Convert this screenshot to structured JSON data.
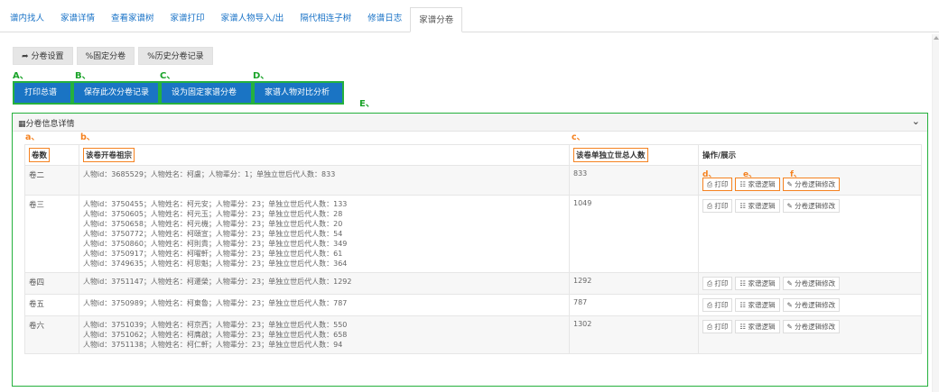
{
  "nav": {
    "tabs": [
      {
        "label": "谱内找人",
        "active": false
      },
      {
        "label": "家谱详情",
        "active": false
      },
      {
        "label": "查看家谱树",
        "active": false
      },
      {
        "label": "家谱打印",
        "active": false
      },
      {
        "label": "家谱人物导入/出",
        "active": false
      },
      {
        "label": "隔代相连子树",
        "active": false
      },
      {
        "label": "修谱日志",
        "active": false
      },
      {
        "label": "家谱分卷",
        "active": true
      }
    ]
  },
  "toolbar": {
    "volume_settings": "分卷设置",
    "fixed_volumes": "%固定分卷",
    "history_volumes": "%历史分卷记录"
  },
  "actions": {
    "print_all": "打印总谱",
    "save_record": "保存此次分卷记录",
    "set_fixed": "设为固定家谱分卷",
    "compare": "家谱人物对比分析"
  },
  "annotations": {
    "A": "A、",
    "B": "B、",
    "C": "C、",
    "D": "D、",
    "E": "E、",
    "a": "a、",
    "b": "b、",
    "c": "c、",
    "d": "d、",
    "e": "e、",
    "f": "f、"
  },
  "panel": {
    "title": "分卷信息详情",
    "columns": {
      "volume": "卷数",
      "founder": "该卷开卷祖宗",
      "total": "该卷单独立世总人数",
      "ops": "操作/展示"
    },
    "op_labels": {
      "print": "打印",
      "tree": "家谱逻辑",
      "edit": "分卷逻辑修改"
    },
    "rows": [
      {
        "volume": "卷二",
        "total": "833",
        "lines": [
          "人物id：3685529；人物姓名：柯盧；人物辈分：1；单独立世后代人数：833"
        ]
      },
      {
        "volume": "卷三",
        "total": "1049",
        "lines": [
          "人物id：3750455；人物姓名：柯元安；人物辈分：23；单独立世后代人数：133",
          "人物id：3750605；人物姓名：柯元玉；人物辈分：23；单独立世后代人数：28",
          "人物id：3750658；人物姓名：柯元機；人物辈分：23；单独立世后代人数：20",
          "人物id：3750772；人物姓名：柯頤宣；人物辈分：23；单独立世后代人数：54",
          "人物id：3750860；人物姓名：柯則貴；人物辈分：23；单独立世后代人数：349",
          "人物id：3750917；人物姓名：柯曜軒；人物辈分：23；单独立世后代人数：61",
          "人物id：3749635；人物姓名：柯思魁；人物辈分：23；单独立世后代人数：364"
        ]
      },
      {
        "volume": "卷四",
        "total": "1292",
        "lines": [
          "人物id：3751147；人物姓名：柯遷榮；人物辈分：23；单独立世后代人数：1292"
        ]
      },
      {
        "volume": "卷五",
        "total": "787",
        "lines": [
          "人物id：3750989；人物姓名：柯東魯；人物辈分：23；单独立世后代人数：787"
        ]
      },
      {
        "volume": "卷六",
        "total": "1302",
        "lines": [
          "人物id：3751039；人物姓名：柯京西；人物辈分：23；单独立世后代人数：550",
          "人物id：3751062；人物姓名：柯膺啟；人物辈分：23；单独立世后代人数：658",
          "人物id：3751138；人物姓名：柯仁軒；人物辈分：23；单独立世后代人数：94"
        ]
      }
    ]
  },
  "colors": {
    "link_blue": "#1a73c7",
    "primary_blue": "#1a74c4",
    "annotation_green": "#1aa329",
    "annotation_orange": "#f58220"
  },
  "icons": [
    "share-icon",
    "link-icon",
    "table-icon",
    "chevron-down-icon",
    "print-icon",
    "sitemap-icon",
    "edit-icon"
  ]
}
